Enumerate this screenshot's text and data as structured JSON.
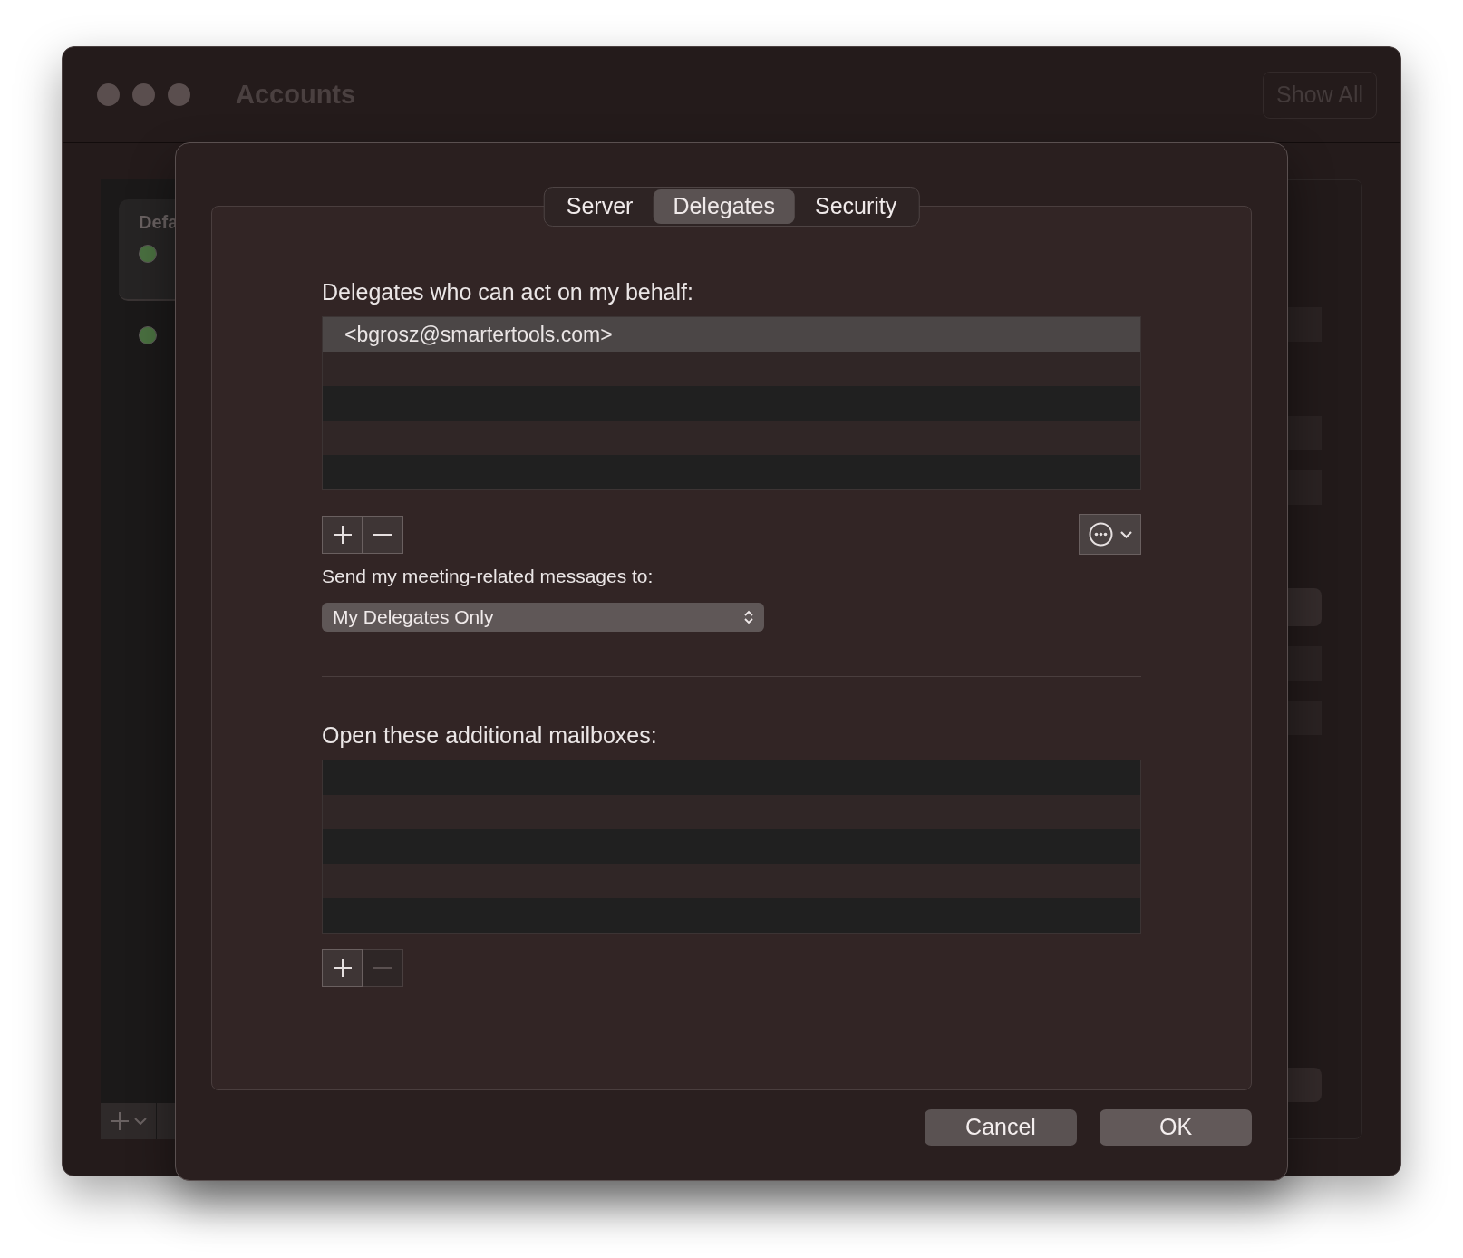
{
  "window": {
    "title": "Accounts",
    "show_all": "Show All",
    "sidebar_heading": "Defa"
  },
  "dialog": {
    "tabs": [
      {
        "label": "Server",
        "selected": false
      },
      {
        "label": "Delegates",
        "selected": true
      },
      {
        "label": "Security",
        "selected": false
      }
    ],
    "delegates": {
      "label": "Delegates who can act on my behalf:",
      "rows": [
        {
          "text": "<bgrosz@smartertools.com>",
          "selected": true
        }
      ],
      "remove_disabled": false
    },
    "meeting": {
      "label": "Send my meeting-related messages to:",
      "value": "My Delegates Only"
    },
    "mailboxes": {
      "label": "Open these additional mailboxes:",
      "remove_disabled": true
    },
    "buttons": [
      {
        "label": "Cancel",
        "kind": "cancel"
      },
      {
        "label": "OK",
        "kind": "ok"
      }
    ]
  }
}
